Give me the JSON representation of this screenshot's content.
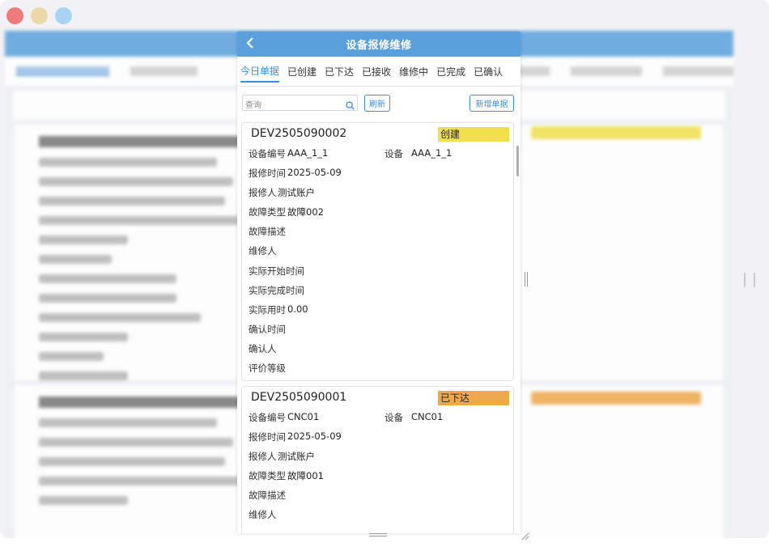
{
  "window": {
    "traffic_colors": [
      "#ef7c7c",
      "#ead9a6",
      "#a9d3f2"
    ]
  },
  "header": {
    "title": "设备报修维修",
    "back_icon": "chevron-left-icon"
  },
  "tabs": [
    {
      "label": "今日单据",
      "active": true
    },
    {
      "label": "已创建",
      "active": false
    },
    {
      "label": "已下达",
      "active": false
    },
    {
      "label": "已接收",
      "active": false
    },
    {
      "label": "维修中",
      "active": false
    },
    {
      "label": "已完成",
      "active": false
    },
    {
      "label": "已确认",
      "active": false
    }
  ],
  "toolbar": {
    "search_placeholder": "查询",
    "refresh_label": "刷新",
    "new_label": "新增单据"
  },
  "cards": [
    {
      "id": "DEV2505090002",
      "status": "创建",
      "status_color": "#f0e14a",
      "rows": [
        {
          "label": "设备编号",
          "value": "AAA_1_1",
          "label2": "设备",
          "value2": "AAA_1_1"
        },
        {
          "label": "报修时间",
          "value": "2025-05-09"
        },
        {
          "label": "报修人",
          "value": "测试账户"
        },
        {
          "label": "故障类型",
          "value": "故障002"
        },
        {
          "label": "故障描述",
          "value": ""
        },
        {
          "label": "维修人",
          "value": ""
        },
        {
          "label": "实际开始时间",
          "value": ""
        },
        {
          "label": "实际完成时间",
          "value": ""
        },
        {
          "label": "实际用时",
          "value": "0.00"
        },
        {
          "label": "确认时间",
          "value": ""
        },
        {
          "label": "确认人",
          "value": ""
        },
        {
          "label": "评价等级",
          "value": ""
        }
      ]
    },
    {
      "id": "DEV2505090001",
      "status": "已下达",
      "status_color": "#eeaa4a",
      "rows": [
        {
          "label": "设备编号",
          "value": "CNC01",
          "label2": "设备",
          "value2": "CNC01"
        },
        {
          "label": "报修时间",
          "value": "2025-05-09"
        },
        {
          "label": "报修人",
          "value": "测试账户"
        },
        {
          "label": "故障类型",
          "value": "故障001"
        },
        {
          "label": "故障描述",
          "value": ""
        },
        {
          "label": "维修人",
          "value": ""
        }
      ]
    }
  ],
  "colors": {
    "primary": "#5aa0dc",
    "accent": "#3a8ee6"
  }
}
